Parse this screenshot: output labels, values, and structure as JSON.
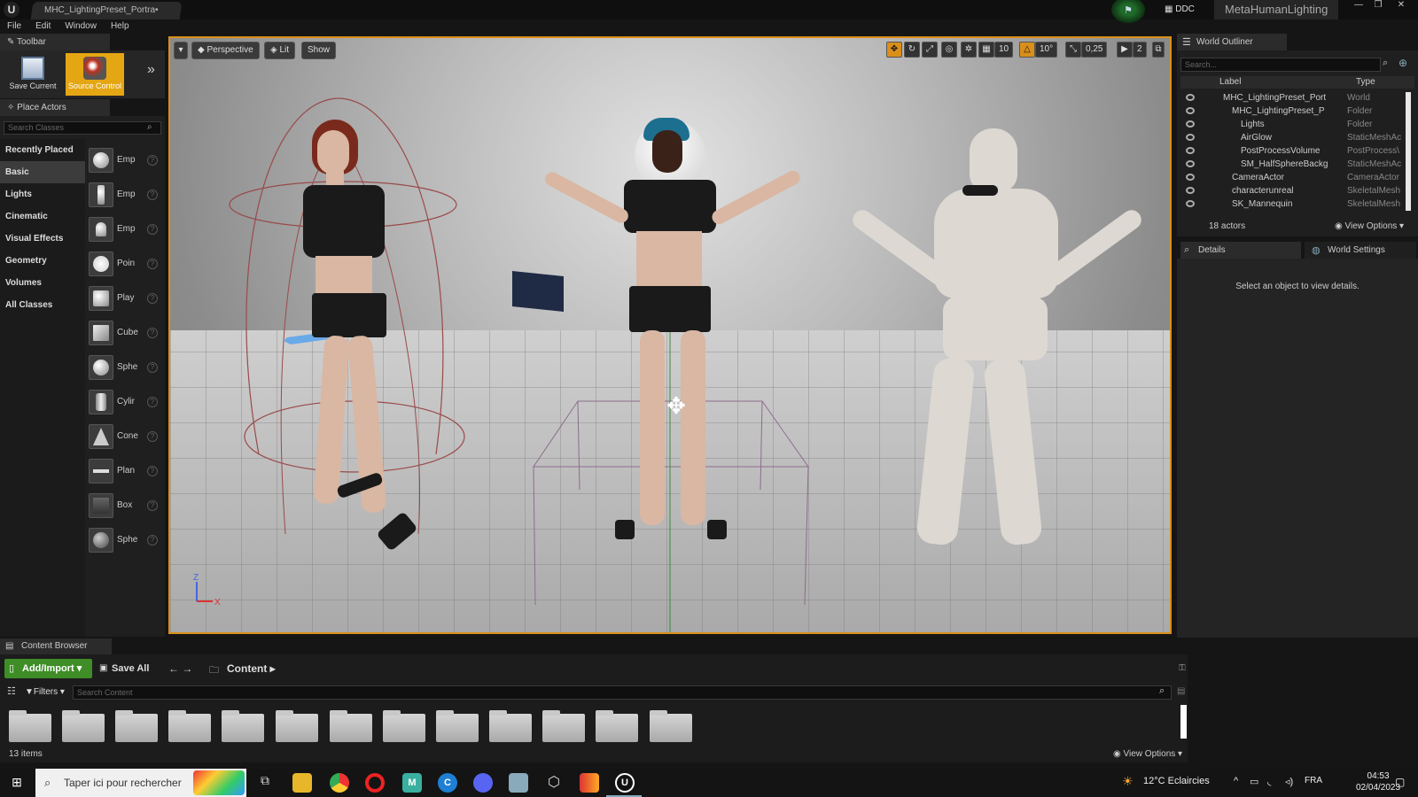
{
  "titlebar": {
    "doc_tab": "MHC_LightingPreset_Portra•",
    "ddc": "DDC",
    "project": "MetaHumanLighting",
    "min": "—",
    "max": "❐",
    "close": "✕"
  },
  "menu": [
    "File",
    "Edit",
    "Window",
    "Help"
  ],
  "toolbar": {
    "tab": "Toolbar",
    "save_current": "Save Current",
    "source_control": "Source Control",
    "more": "»"
  },
  "place_actors": {
    "tab": "Place Actors",
    "search_placeholder": "Search Classes",
    "categories": [
      "Recently Placed",
      "Basic",
      "Lights",
      "Cinematic",
      "Visual Effects",
      "Geometry",
      "Volumes",
      "All Classes"
    ],
    "active_category": "Basic",
    "actors": [
      "Emp",
      "Emp",
      "Emp",
      "Poin",
      "Play",
      "Cube",
      "Sphe",
      "Cylir",
      "Cone",
      "Plan",
      "Box",
      "Sphe"
    ]
  },
  "viewport": {
    "perspective": "Perspective",
    "lit": "Lit",
    "show": "Show",
    "grid_snap": "10",
    "rot_snap": "10°",
    "scale_snap": "0,25",
    "cam_speed": "2"
  },
  "outliner": {
    "tab": "World Outliner",
    "search_placeholder": "Search...",
    "col_label": "Label",
    "col_type": "Type",
    "rows": [
      {
        "name": "MHC_LightingPreset_Port",
        "type": "World"
      },
      {
        "name": "MHC_LightingPreset_P",
        "type": "Folder"
      },
      {
        "name": "Lights",
        "type": "Folder"
      },
      {
        "name": "AirGlow",
        "type": "StaticMeshAc"
      },
      {
        "name": "PostProcessVolume",
        "type": "PostProcess\\"
      },
      {
        "name": "SM_HalfSphereBackg",
        "type": "StaticMeshAc"
      },
      {
        "name": "CameraActor",
        "type": "CameraActor"
      },
      {
        "name": "characterunreal",
        "type": "SkeletalMesh"
      },
      {
        "name": "SK_Mannequin",
        "type": "SkeletalMesh"
      }
    ],
    "count": "18 actors",
    "view_options": "View Options"
  },
  "details": {
    "tab": "Details",
    "world_settings_tab": "World Settings",
    "empty_msg": "Select an object to view details."
  },
  "content_browser": {
    "tab": "Content Browser",
    "add_import": "Add/Import",
    "save_all": "Save All",
    "path": "Content",
    "filters": "Filters",
    "search_placeholder": "Search Content",
    "items_count": "13 items",
    "view_options": "View Options"
  },
  "taskbar": {
    "search_placeholder": "Taper ici pour rechercher",
    "weather": "12°C  Eclaircies",
    "lang": "FRA",
    "time": "04:53",
    "date": "02/04/2023"
  },
  "colors": {
    "accent": "#d98f1a",
    "add_import_green": "#3e8d26",
    "source_control_yellow": "#e5a613"
  }
}
